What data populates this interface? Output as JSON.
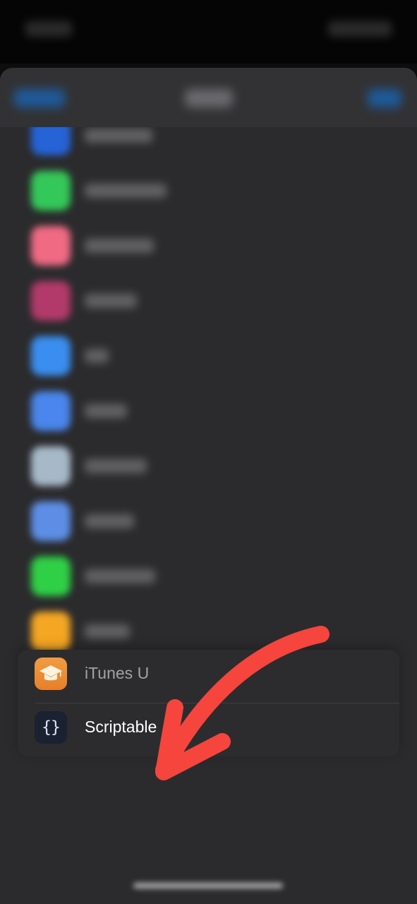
{
  "colors": {
    "background": "#0d0d0e",
    "sheet": "#2b2b2d",
    "card": "#2c2c2e",
    "annotation_arrow": "#f5453d",
    "itunes_icon": "#ec8a33",
    "scriptable_icon": "#1a2130"
  },
  "list": {
    "blurred_rows": [
      {
        "icon": "blurred-blue-app-icon",
        "color": "#2563d6"
      },
      {
        "icon": "blurred-green-app-icon",
        "color": "#34c759"
      },
      {
        "icon": "blurred-pink-app-icon",
        "color": "#f06a84"
      },
      {
        "icon": "blurred-magenta-app-icon",
        "color": "#b23a6a"
      },
      {
        "icon": "blurred-blue-app-icon",
        "color": "#3a8ef0"
      },
      {
        "icon": "blurred-blue-app-icon",
        "color": "#4a86ec"
      },
      {
        "icon": "blurred-gray-app-icon",
        "color": "#a7b9c8"
      },
      {
        "icon": "blurred-blue-app-icon",
        "color": "#5d8ee6"
      },
      {
        "icon": "blurred-green-app-icon",
        "color": "#2fd046"
      },
      {
        "icon": "blurred-orange-app-icon",
        "color": "#f5a623"
      },
      {
        "icon": "blurred-pink-app-icon",
        "color": "#e8657f"
      }
    ],
    "focused_items": [
      {
        "label": "iTunes U",
        "icon": "graduation-cap-icon"
      },
      {
        "label": "Scriptable",
        "icon": "curly-braces-icon",
        "icon_glyph": "{}"
      }
    ]
  },
  "annotation": {
    "icon": "red-arrow-icon"
  }
}
